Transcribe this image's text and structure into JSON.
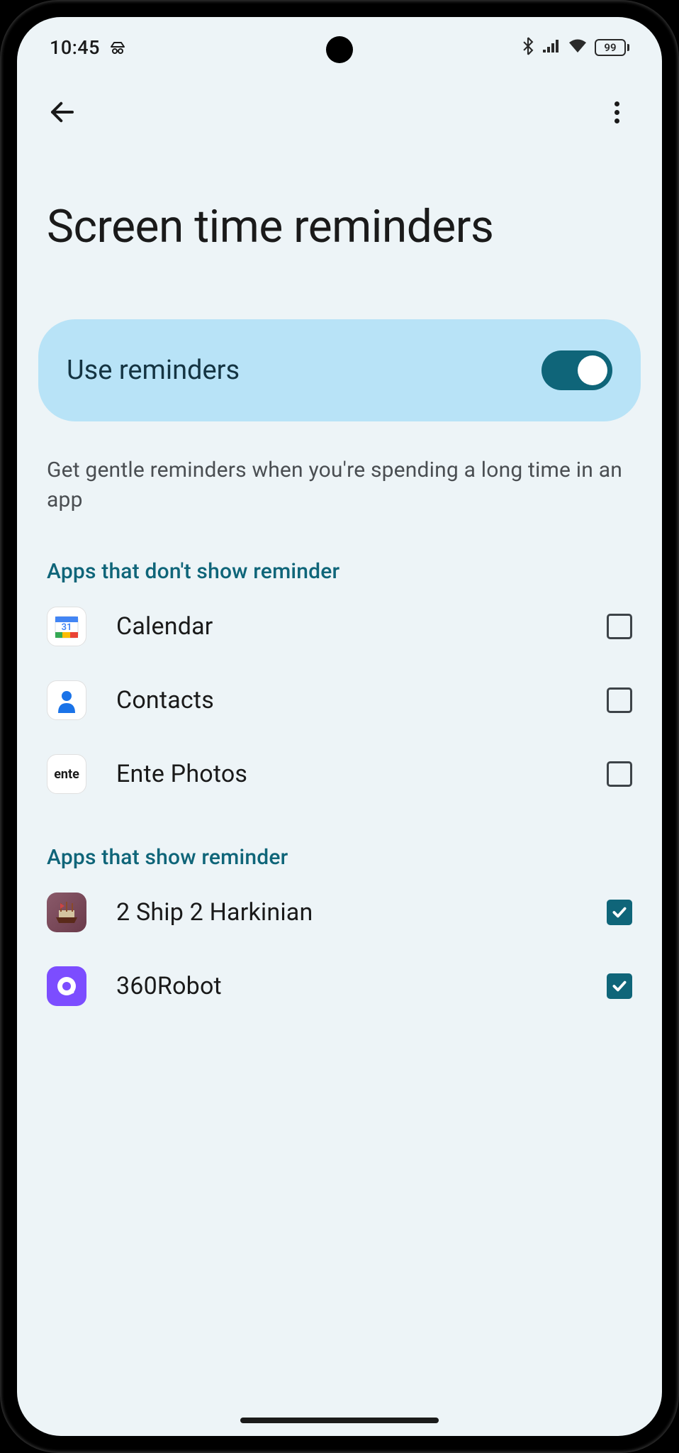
{
  "status_bar": {
    "time": "10:45",
    "battery": "99"
  },
  "page": {
    "title": "Screen time reminders"
  },
  "toggle": {
    "label": "Use reminders",
    "enabled": true
  },
  "description": "Get gentle reminders when you're spending a long time in an app",
  "sections": {
    "no_reminder": {
      "header": "Apps that don't show reminder",
      "apps": [
        {
          "name": "Calendar",
          "icon": "calendar",
          "checked": false
        },
        {
          "name": "Contacts",
          "icon": "contacts",
          "checked": false
        },
        {
          "name": "Ente Photos",
          "icon": "ente",
          "checked": false
        }
      ]
    },
    "reminder": {
      "header": "Apps that show reminder",
      "apps": [
        {
          "name": "2 Ship 2 Harkinian",
          "icon": "ship",
          "checked": true
        },
        {
          "name": "360Robot",
          "icon": "robot",
          "checked": true
        }
      ]
    }
  }
}
